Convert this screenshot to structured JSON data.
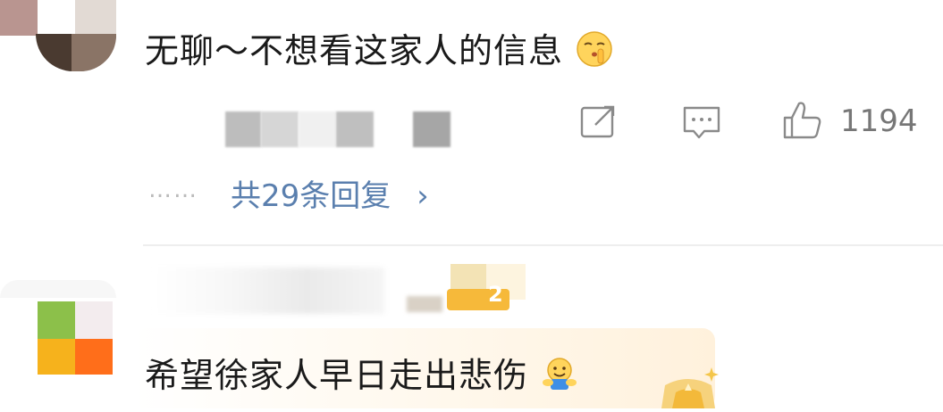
{
  "comments": [
    {
      "text": "无聊～不想看这家人的信息",
      "emoji": "shushing-face",
      "likes": "1194",
      "replies_label": "共29条回复",
      "replies_chevron": "›",
      "replies_dots": "……"
    },
    {
      "text": "希望徐家人早日走出悲伤",
      "emoji": "hugging-face",
      "badge_level": "2"
    }
  ],
  "colors": {
    "text": "#1a1a1a",
    "link": "#5a7fae",
    "muted": "#777777",
    "divider": "#eeeeee"
  }
}
